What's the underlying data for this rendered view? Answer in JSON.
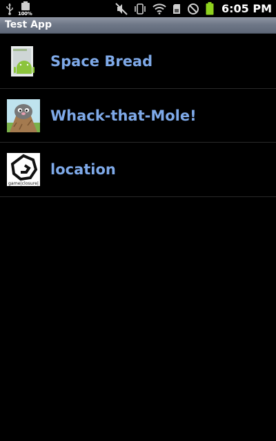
{
  "status_bar": {
    "left_icons": [
      "usb-icon",
      "battery-full-icon"
    ],
    "battery_percent": "100%",
    "right_icons": [
      "mute-icon",
      "vibrate-icon",
      "wifi-icon",
      "sd-card-icon",
      "blocked-icon",
      "battery-icon"
    ],
    "time": "6:05 PM"
  },
  "title_bar": {
    "title": "Test App"
  },
  "apps": [
    {
      "label": "Space Bread",
      "icon": "android-package-icon"
    },
    {
      "label": "Whack-that-Mole!",
      "icon": "mole-icon"
    },
    {
      "label": "location",
      "icon": "game-closure-icon",
      "icon_caption": "game|closure|"
    }
  ],
  "colors": {
    "background": "#000000",
    "title_bar": "#6f7888",
    "item_label": "#7ea9e8",
    "divider": "#2a2a2a",
    "battery_green": "#8fd21e"
  }
}
